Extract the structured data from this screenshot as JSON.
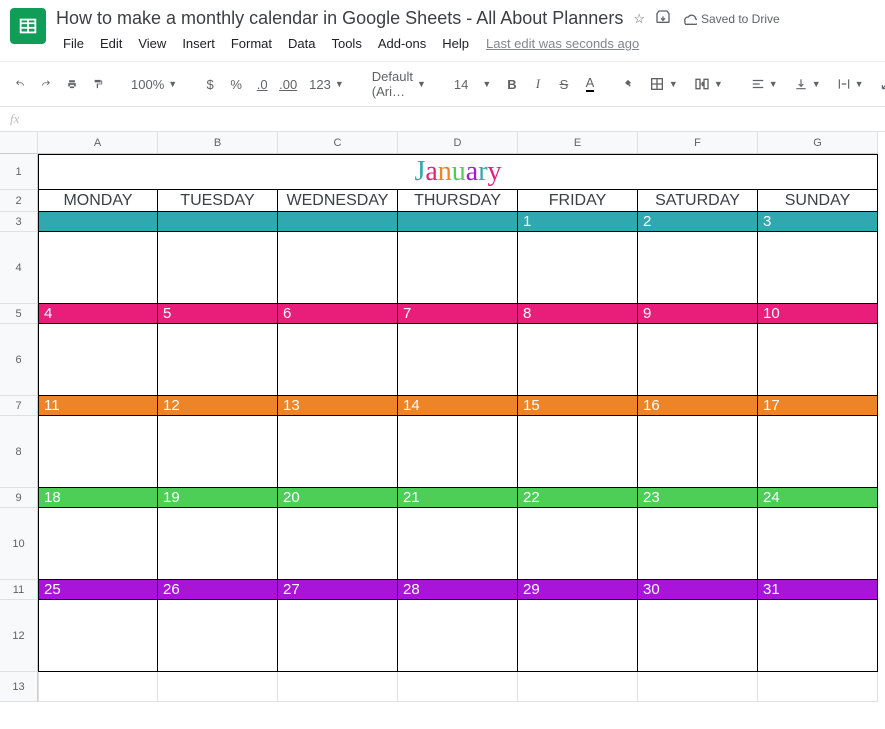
{
  "header": {
    "doc_title": "How to make a monthly calendar in Google Sheets - All About Planners",
    "saved_label": "Saved to Drive",
    "menu": [
      "File",
      "Edit",
      "View",
      "Insert",
      "Format",
      "Data",
      "Tools",
      "Add-ons",
      "Help"
    ],
    "last_edit": "Last edit was seconds ago"
  },
  "toolbar": {
    "zoom": "100%",
    "font": "Default (Ari…",
    "font_size": "14",
    "currency": "$",
    "percent": "%",
    "dec_dec": ".0",
    "dec_inc": ".00",
    "num_format": "123",
    "bold": "B",
    "italic": "I",
    "strike": "S",
    "text_color": "A"
  },
  "fx": "fx",
  "columns": [
    "A",
    "B",
    "C",
    "D",
    "E",
    "F",
    "G"
  ],
  "row_numbers": [
    "1",
    "2",
    "3",
    "4",
    "5",
    "6",
    "7",
    "8",
    "9",
    "10",
    "11",
    "12",
    "13"
  ],
  "calendar": {
    "month_letters": [
      {
        "t": "J",
        "c": "#2fa8b0"
      },
      {
        "t": "a",
        "c": "#e91e7a"
      },
      {
        "t": "n",
        "c": "#ed8427"
      },
      {
        "t": "u",
        "c": "#4dce57"
      },
      {
        "t": "a",
        "c": "#a815d8"
      },
      {
        "t": "r",
        "c": "#2fa8b0"
      },
      {
        "t": "y",
        "c": "#e91e7a"
      }
    ],
    "days": [
      "MONDAY",
      "TUESDAY",
      "WEDNESDAY",
      "THURSDAY",
      "FRIDAY",
      "SATURDAY",
      "SUNDAY"
    ],
    "weeks": [
      {
        "color": "c-teal",
        "dates": [
          "",
          "",
          "",
          "",
          "1",
          "2",
          "3"
        ]
      },
      {
        "color": "c-pink",
        "dates": [
          "4",
          "5",
          "6",
          "7",
          "8",
          "9",
          "10"
        ]
      },
      {
        "color": "c-orange",
        "dates": [
          "11",
          "12",
          "13",
          "14",
          "15",
          "16",
          "17"
        ]
      },
      {
        "color": "c-green",
        "dates": [
          "18",
          "19",
          "20",
          "21",
          "22",
          "23",
          "24"
        ]
      },
      {
        "color": "c-purple",
        "dates": [
          "25",
          "26",
          "27",
          "28",
          "29",
          "30",
          "31"
        ]
      }
    ]
  },
  "row_heights": {
    "title": 36,
    "dayhead": 22,
    "date": 20,
    "body": 72,
    "body_last": 60
  }
}
